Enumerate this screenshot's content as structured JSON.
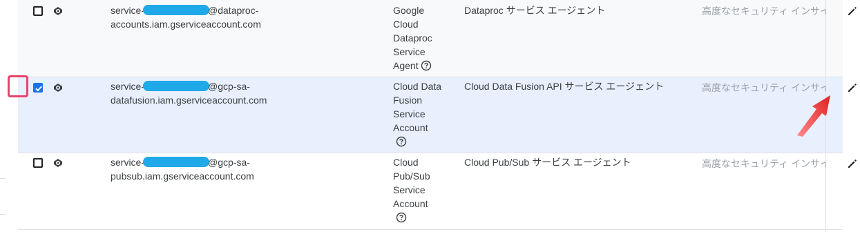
{
  "rows": [
    {
      "email_prefix": "service-",
      "email_suffix_line1": "@dataproc-",
      "email_line2": "accounts.iam.gserviceaccount.com",
      "name_lines": [
        "Google",
        "Cloud",
        "Dataproc",
        "Service",
        "Agent"
      ],
      "description": "Dataproc サービス エージェント",
      "insight": "高度なセキュリティ インサイ",
      "checked": false
    },
    {
      "email_prefix": "service-",
      "email_suffix_line1": "@gcp-sa-",
      "email_line2": "datafusion.iam.gserviceaccount.com",
      "name_lines": [
        "Cloud Data",
        "Fusion",
        "Service",
        "Account"
      ],
      "description": "Cloud Data Fusion API サービス エージェント",
      "insight": "高度なセキュリティ インサイ",
      "checked": true
    },
    {
      "email_prefix": "service-",
      "email_suffix_line1": "@gcp-sa-",
      "email_line2": "pubsub.iam.gserviceaccount.com",
      "name_lines": [
        "Cloud",
        "Pub/Sub",
        "Service",
        "Account"
      ],
      "description": "Cloud Pub/Sub サービス エージェント",
      "insight": "高度なセキュリティ インサイ",
      "checked": false
    }
  ],
  "icons": {
    "row_icon": "eye-visibility-icon",
    "help": "help-circle-icon",
    "edit": "pencil-edit-icon",
    "annotation": "red-arrow-pointer"
  },
  "colors": {
    "selected_row": "#e8f0fe",
    "checkbox_checked": "#1a73e8",
    "highlight": "#e8436a",
    "redaction": "#1fa9e8"
  }
}
